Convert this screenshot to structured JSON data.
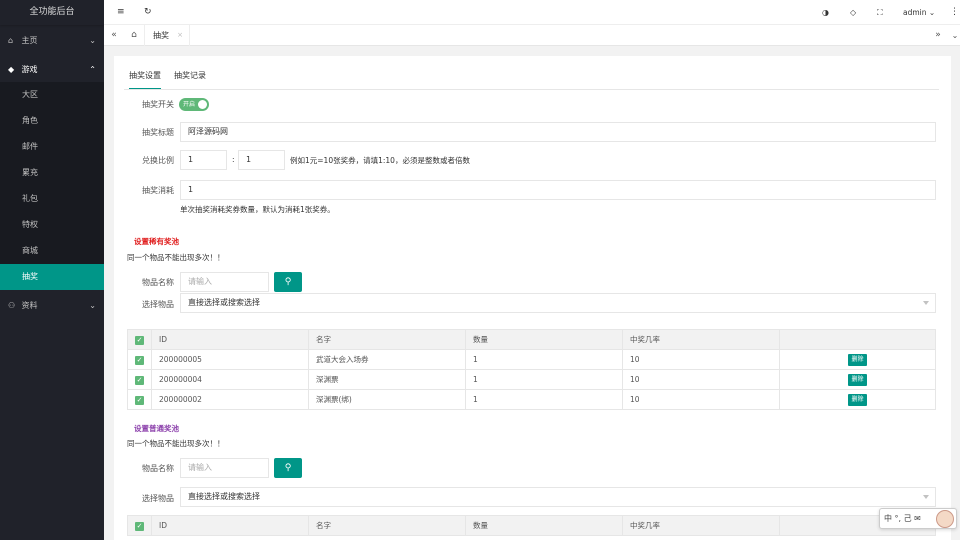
{
  "app": {
    "title": "全功能后台"
  },
  "sidebar": {
    "items": [
      {
        "label": "主页",
        "icon": "home-icon",
        "chevron": "⌄"
      },
      {
        "label": "游戏",
        "icon": "diamond-icon",
        "chevron": "⌃"
      },
      {
        "label": "资料",
        "icon": "user-icon",
        "chevron": "⌄"
      }
    ],
    "sub_items": [
      "大区",
      "角色",
      "邮件",
      "累充",
      "礼包",
      "特权",
      "商城",
      "抽奖"
    ]
  },
  "header": {
    "user": "admin",
    "menu_icon": "≡",
    "refresh_icon": "↻"
  },
  "tabs": {
    "current": "抽奖",
    "close": "×",
    "left_arrow": "«",
    "right_arrow": "»"
  },
  "page_tabs": [
    "抽奖设置",
    "抽奖记录"
  ],
  "form": {
    "switch_label": "抽奖开关",
    "switch_text": "开启",
    "title_label": "抽奖标题",
    "title_value": "阿泽源码网",
    "ratio_label": "兑换比例",
    "ratio_a": "1",
    "ratio_sep": ":",
    "ratio_b": "1",
    "ratio_hint": "例如1元=10张奖券，请填1:10，必须是整数或者倍数",
    "cost_label": "抽奖消耗",
    "cost_value": "1",
    "cost_hint": "单次抽奖消耗奖券数量，默认为消耗1张奖券。"
  },
  "rare_pool": {
    "title": "设置稀有奖池",
    "warning": "同一个物品不能出现多次！！",
    "name_label": "物品名称",
    "name_placeholder": "请输入",
    "select_label": "选择物品",
    "select_value": "直接选择或搜索选择",
    "columns": [
      "ID",
      "名字",
      "数量",
      "中奖几率",
      ""
    ],
    "rows": [
      {
        "id": "200000005",
        "name": "武道大会入场券",
        "qty": "1",
        "rate": "10",
        "action": "删除"
      },
      {
        "id": "200000004",
        "name": "深渊票",
        "qty": "1",
        "rate": "10",
        "action": "删除"
      },
      {
        "id": "200000002",
        "name": "深渊票(绑)",
        "qty": "1",
        "rate": "10",
        "action": "删除"
      }
    ]
  },
  "normal_pool": {
    "title": "设置普通奖池",
    "warning": "同一个物品不能出现多次！！",
    "name_label": "物品名称",
    "name_placeholder": "请输入",
    "select_label": "选择物品",
    "select_value": "直接选择或搜索选择",
    "columns": [
      "ID",
      "名字",
      "数量",
      "中奖几率",
      ""
    ]
  },
  "ime": {
    "text": "中 °, 己 ✉"
  },
  "colors": {
    "accent": "#009688",
    "sidebar": "#20222a",
    "switch": "#5fb878",
    "rare": "#e02020",
    "normal": "#8e44ad"
  }
}
